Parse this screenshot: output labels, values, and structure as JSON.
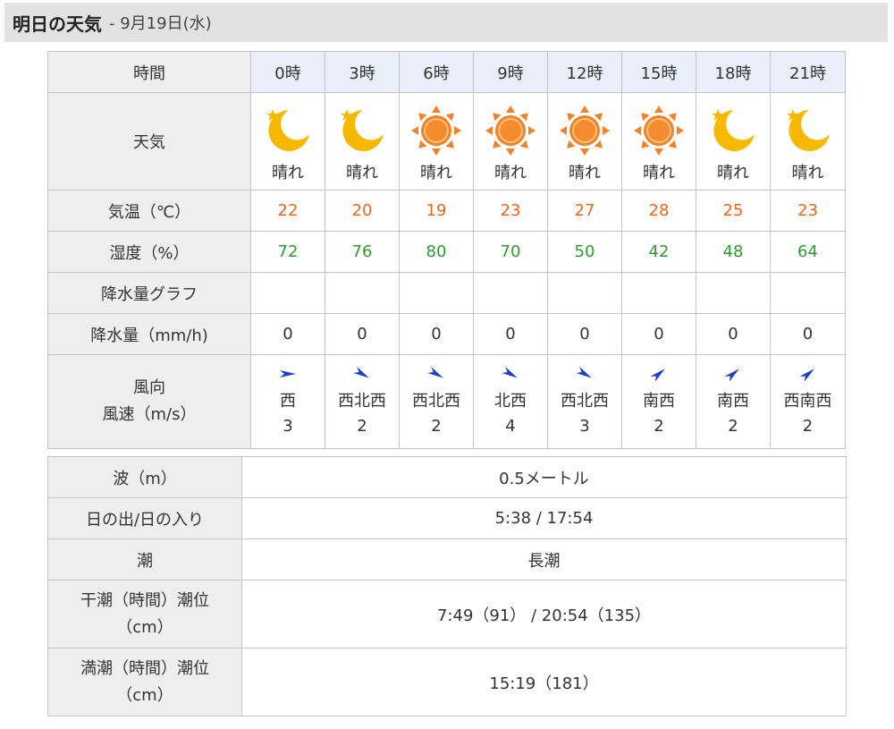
{
  "header": {
    "title": "明日の天気",
    "subtitle": "- 9月19日(水)"
  },
  "forecast": {
    "labels": {
      "time": "時間",
      "weather": "天気",
      "temp": "気温（℃）",
      "humidity": "湿度（%）",
      "precip_graph": "降水量グラフ",
      "precip": "降水量（mm/h)",
      "wind_dir": "風向",
      "wind_speed": "風速（m/s）"
    },
    "hours": [
      {
        "time": "0時",
        "icon": "moon-star-icon",
        "weather": "晴れ",
        "temp": "22",
        "humidity": "72",
        "precip": "0",
        "wind_dir": "西",
        "wind_speed": "3",
        "wind_arrow": "arrow-east-icon"
      },
      {
        "time": "3時",
        "icon": "moon-star-icon",
        "weather": "晴れ",
        "temp": "20",
        "humidity": "76",
        "precip": "0",
        "wind_dir": "西北西",
        "wind_speed": "2",
        "wind_arrow": "arrow-southeast-icon"
      },
      {
        "time": "6時",
        "icon": "sun-icon",
        "weather": "晴れ",
        "temp": "19",
        "humidity": "80",
        "precip": "0",
        "wind_dir": "西北西",
        "wind_speed": "2",
        "wind_arrow": "arrow-southeast-icon"
      },
      {
        "time": "9時",
        "icon": "sun-icon",
        "weather": "晴れ",
        "temp": "23",
        "humidity": "70",
        "precip": "0",
        "wind_dir": "北西",
        "wind_speed": "4",
        "wind_arrow": "arrow-southeast-icon"
      },
      {
        "time": "12時",
        "icon": "sun-icon",
        "weather": "晴れ",
        "temp": "27",
        "humidity": "50",
        "precip": "0",
        "wind_dir": "西北西",
        "wind_speed": "3",
        "wind_arrow": "arrow-southeast-icon"
      },
      {
        "time": "15時",
        "icon": "sun-icon",
        "weather": "晴れ",
        "temp": "28",
        "humidity": "42",
        "precip": "0",
        "wind_dir": "南西",
        "wind_speed": "2",
        "wind_arrow": "arrow-northeast-icon"
      },
      {
        "time": "18時",
        "icon": "moon-star-icon",
        "weather": "晴れ",
        "temp": "25",
        "humidity": "48",
        "precip": "0",
        "wind_dir": "南西",
        "wind_speed": "2",
        "wind_arrow": "arrow-northeast-icon"
      },
      {
        "time": "21時",
        "icon": "moon-star-icon",
        "weather": "晴れ",
        "temp": "23",
        "humidity": "64",
        "precip": "0",
        "wind_dir": "西南西",
        "wind_speed": "2",
        "wind_arrow": "arrow-northeast-icon"
      }
    ]
  },
  "sea": {
    "wave_label": "波（m）",
    "wave_value": "0.5メートル",
    "sun_label": "日の出/日の入り",
    "sun_value": "5:38 / 17:54",
    "tide_label": "潮",
    "tide_value": "長潮",
    "low_tide_label_1": "干潮（時間）潮位",
    "low_tide_label_2": "（cm）",
    "low_tide_value": "7:49（91） / 20:54（135）",
    "high_tide_label_1": "満潮（時間）潮位",
    "high_tide_label_2": "（cm）",
    "high_tide_value": "15:19（181）"
  },
  "colors": {
    "temp": "#e9661e",
    "humidity": "#2f9b2f",
    "moon": "#f7b800",
    "sun": "#f0822a",
    "arrow": "#1a3fc9",
    "header_bg": "#e2e2e2",
    "row_head_bg": "#eeeeee",
    "time_bg": "#e9effa"
  }
}
